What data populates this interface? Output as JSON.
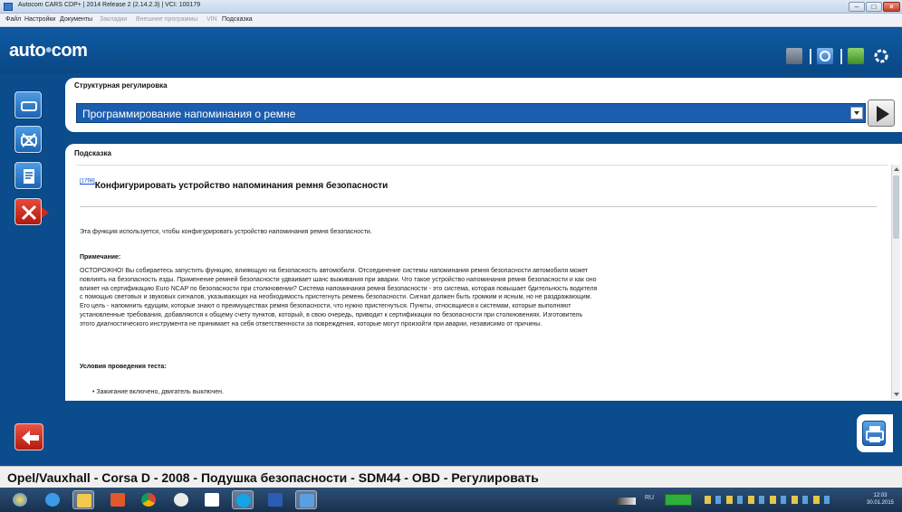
{
  "window": {
    "title": "Autocom CARS CDP+ | 2014 Release 2 (2.14.2.3) | VCI: 100179"
  },
  "menu": [
    {
      "label": "Файл",
      "enabled": true
    },
    {
      "label": "Настройки",
      "enabled": true
    },
    {
      "label": "Документы",
      "enabled": true
    },
    {
      "label": "Закладки",
      "enabled": false
    },
    {
      "label": "Внешние программы",
      "enabled": false
    },
    {
      "label": "VIN",
      "enabled": false
    },
    {
      "label": "Подсказка",
      "enabled": true
    }
  ],
  "header": {
    "logo_left": "auto",
    "logo_dot": "•",
    "logo_right": "com",
    "icons": [
      "car-settings-icon",
      "help-icon",
      "update-icon",
      "loading-icon"
    ]
  },
  "sidebar": {
    "items": [
      {
        "icon": "ecu-connect-icon",
        "active": false
      },
      {
        "icon": "ecu-disconnect-icon",
        "active": false
      },
      {
        "icon": "report-icon",
        "active": false
      },
      {
        "icon": "tools-icon",
        "active": true
      }
    ],
    "back_icon": "back-arrow-icon"
  },
  "structured_adjustment": {
    "title": "Структурная регулировка",
    "selected": "Программирование напоминания о ремне"
  },
  "hint": {
    "title": "Подсказка",
    "doc_ref": "[1798]",
    "doc_title": "Конфигурировать устройство напоминания ремня безопасности",
    "intro": "Эта функция используется, чтобы конфигурировать устройство напоминания ремня безопасности.",
    "note_heading": "Примечание:",
    "warning_lines": [
      "ОСТОРОЖНО! Вы собираетесь запустить функцию, влияющую на безопасность автомобиля. Отсоединение системы напоминания ремня безопасности автомобиля может",
      "повлиять на безопасность езды. Применение ремней безопасности удваивает шанс выживания при аварии. Что такое устройство напоминания ремня безопасности и как оно",
      "влияет на сертификацию Euro NCAP по безопасности при столкновении? Система напоминания ремня безопасности - это система, которая повышает бдительность водителя",
      "с помощью световых и звуковых сигналов, указывающих на необходимость пристегнуть ремень безопасности. Сигнал должен быть громким и ясным, но не раздражающим.",
      "Его цель - напомнить едущим, которые знают о преимуществах ремня безопасности, что нужно пристегнуться. Пункты, относящиеся к системам, которые выполняют",
      "установленные требования, добавляются к общему счету пунктов, который, в свою очередь, приводит к сертификации по безопасности при столкновениях. Изготовитель",
      "этого диагностического инструмента не принимает на себя ответственности за повреждения, которые могут произойти при аварии, независимо от причины."
    ],
    "conditions_heading": "Условия проведения теста:",
    "conditions": [
      "Зажигание включено, двигатель выключен."
    ]
  },
  "status_bar": {
    "text": "Opel/Vauxhall - Corsa D - 2008 - Подушка безопасности - SDM44 - OBD - Регулировать"
  },
  "taskbar": {
    "apps": [
      "windows-start-icon",
      "ie-icon",
      "explorer-icon",
      "app-icon",
      "chrome-icon",
      "media-icon",
      "yandex-icon",
      "skype-icon",
      "word-icon",
      "autocom-icon"
    ],
    "tray_lang": "RU",
    "clock_time": "12:03",
    "clock_date": "30.01.2015"
  },
  "colors": {
    "accent_blue": "#0b4d8c",
    "select_blue": "#1b5eaf",
    "active_red": "#d02a1d"
  }
}
